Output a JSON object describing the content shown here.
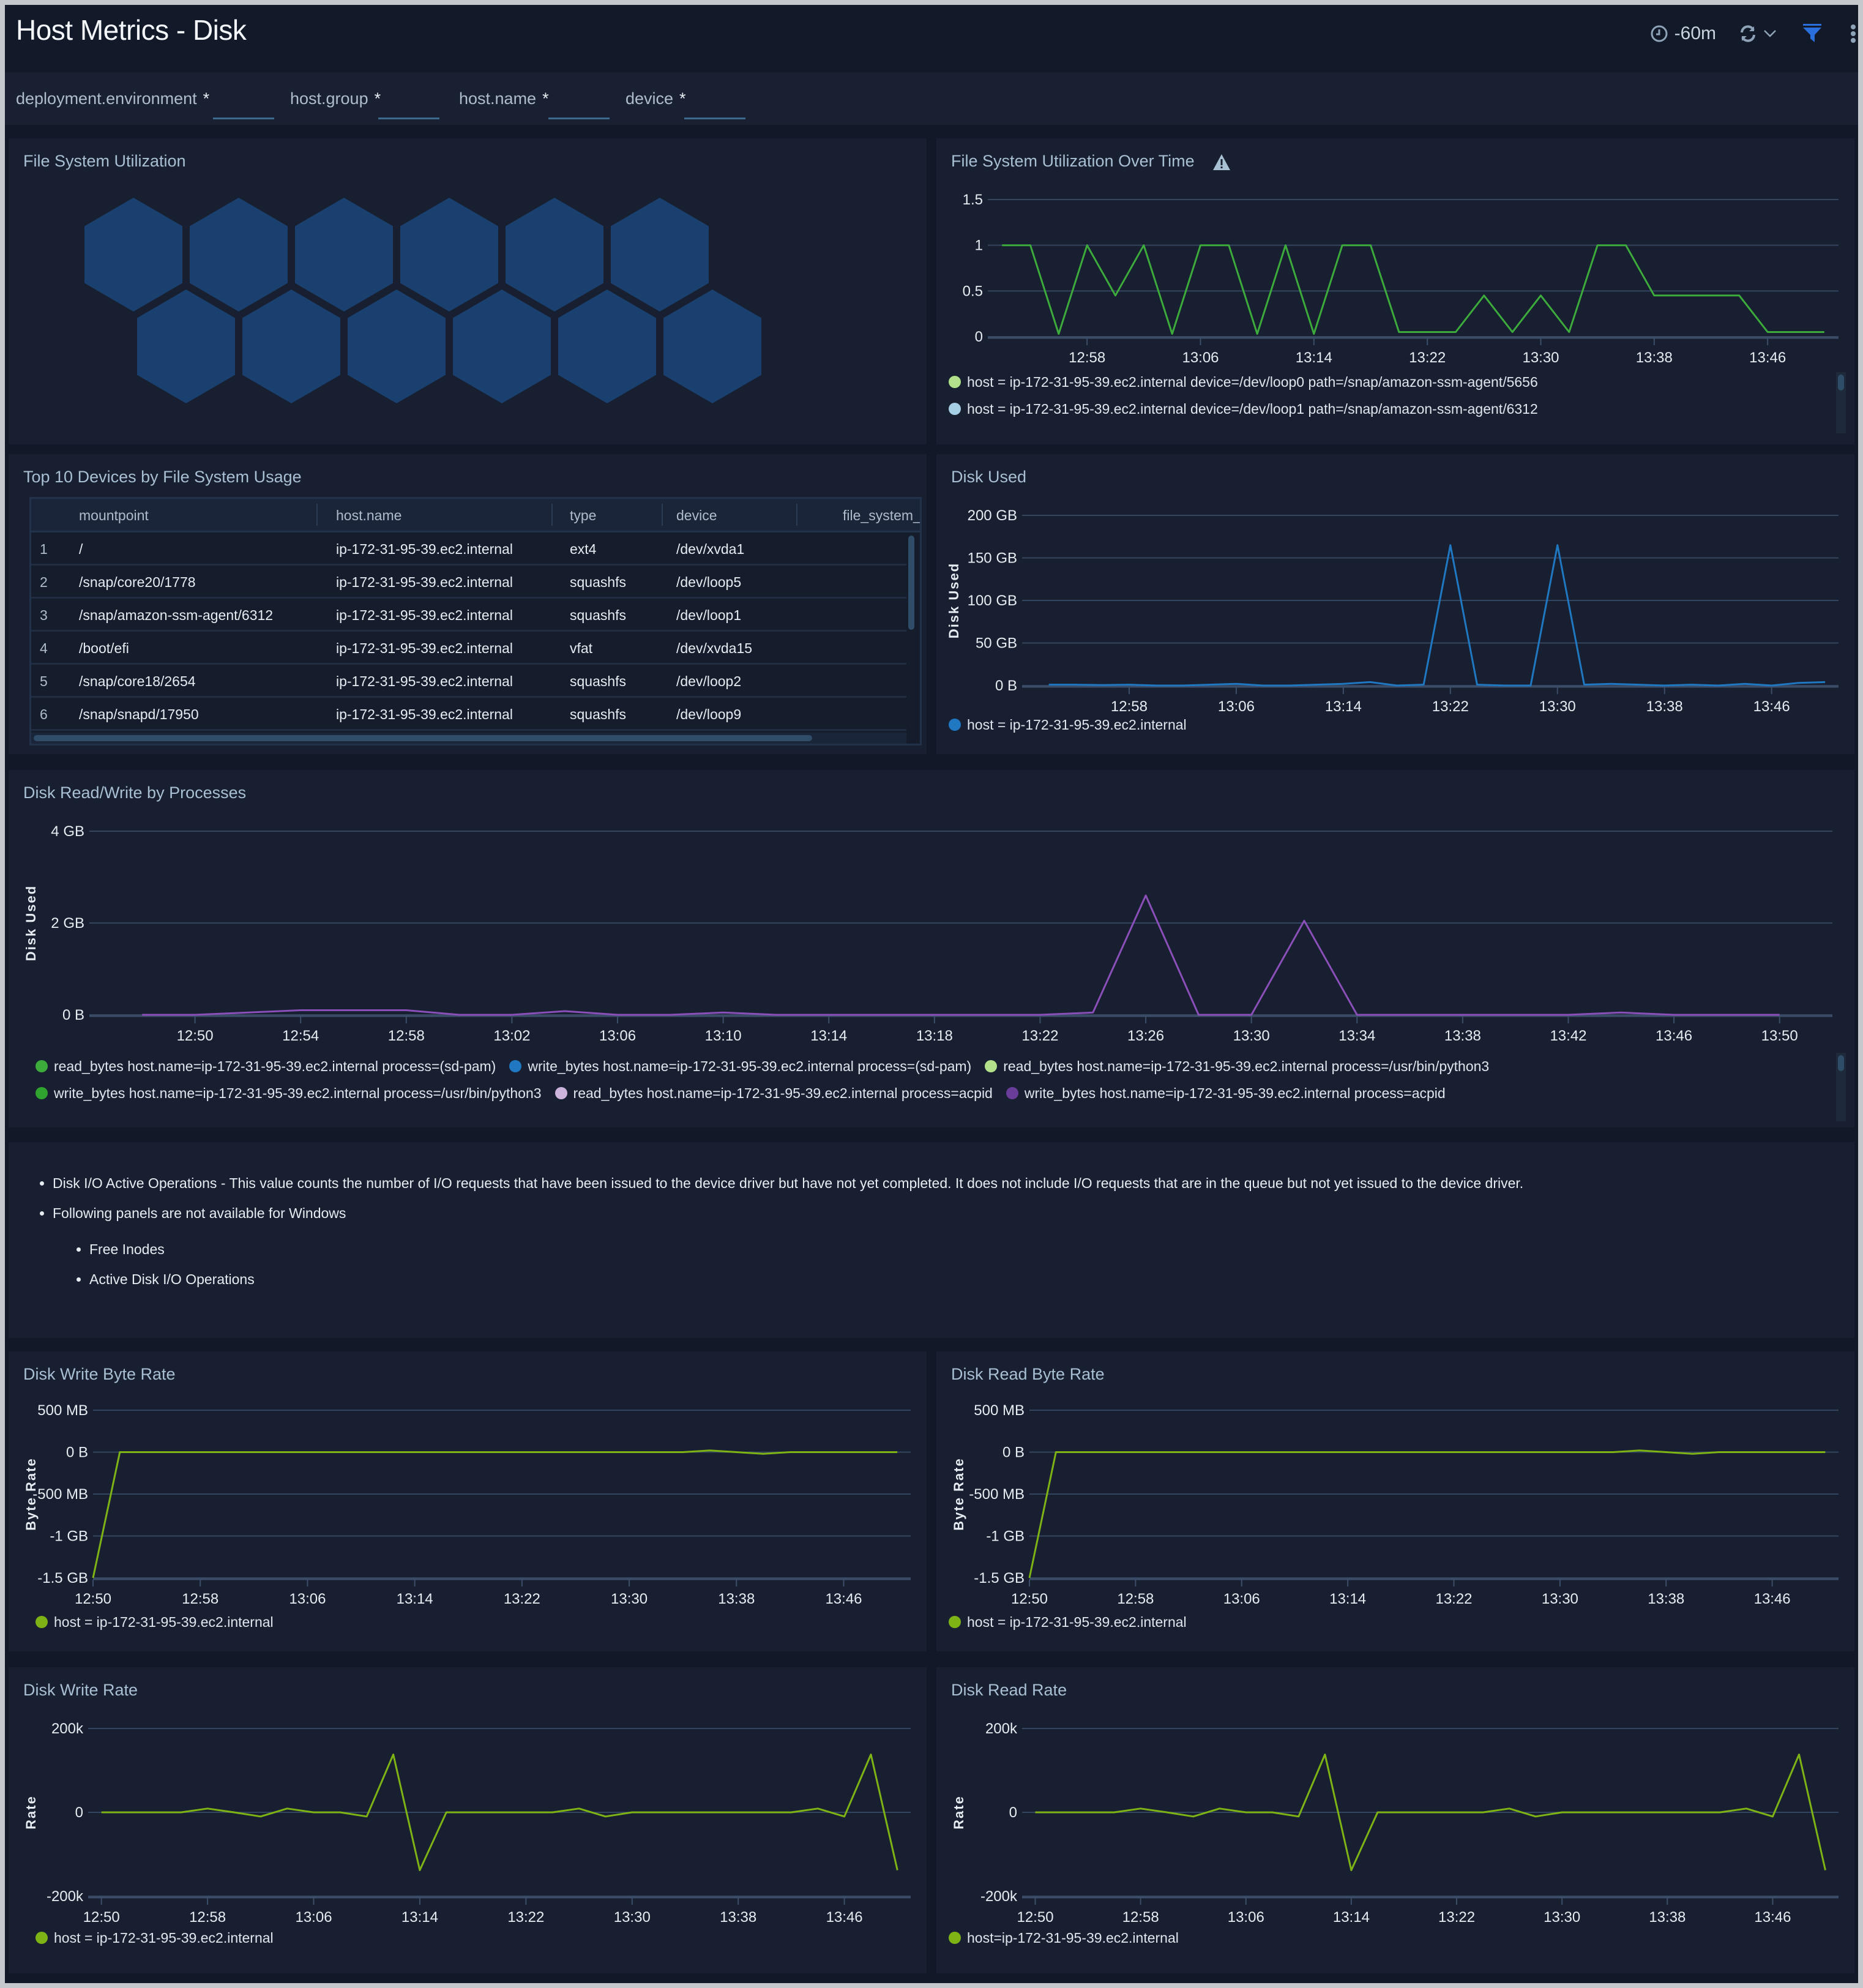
{
  "header": {
    "title": "Host Metrics - Disk",
    "time_range": "-60m",
    "icons": [
      "clock-icon",
      "refresh-icon",
      "chevron-down-icon",
      "filter-icon",
      "more-vertical-icon"
    ]
  },
  "filters": [
    {
      "label": "deployment.environment",
      "value": "*"
    },
    {
      "label": "host.group",
      "value": "*"
    },
    {
      "label": "host.name",
      "value": "*"
    },
    {
      "label": "device",
      "value": "*"
    }
  ],
  "panels": {
    "fs_util": {
      "title": "File System Utilization",
      "hex_count": 12,
      "hex_color": "#1a406f"
    },
    "fs_util_time": {
      "title": "File System Utilization Over Time",
      "warning_icon": "warning-icon"
    },
    "top10": {
      "title": "Top 10 Devices by File System Usage"
    },
    "disk_used": {
      "title": "Disk Used"
    },
    "rw_processes": {
      "title": "Disk Read/Write by Processes"
    },
    "write_byte_rate": {
      "title": "Disk Write Byte Rate"
    },
    "read_byte_rate": {
      "title": "Disk Read Byte Rate"
    },
    "write_rate": {
      "title": "Disk Write Rate"
    },
    "read_rate": {
      "title": "Disk Read Rate"
    }
  },
  "table": {
    "columns": [
      "mountpoint",
      "host.name",
      "type",
      "device",
      "file_system_"
    ],
    "rows": [
      {
        "idx": "1",
        "mountpoint": "/",
        "host": "ip-172-31-95-39.ec2.internal",
        "type": "ext4",
        "device": "/dev/xvda1"
      },
      {
        "idx": "2",
        "mountpoint": "/snap/core20/1778",
        "host": "ip-172-31-95-39.ec2.internal",
        "type": "squashfs",
        "device": "/dev/loop5"
      },
      {
        "idx": "3",
        "mountpoint": "/snap/amazon-ssm-agent/6312",
        "host": "ip-172-31-95-39.ec2.internal",
        "type": "squashfs",
        "device": "/dev/loop1"
      },
      {
        "idx": "4",
        "mountpoint": "/boot/efi",
        "host": "ip-172-31-95-39.ec2.internal",
        "type": "vfat",
        "device": "/dev/xvda15"
      },
      {
        "idx": "5",
        "mountpoint": "/snap/core18/2654",
        "host": "ip-172-31-95-39.ec2.internal",
        "type": "squashfs",
        "device": "/dev/loop2"
      },
      {
        "idx": "6",
        "mountpoint": "/snap/snapd/17950",
        "host": "ip-172-31-95-39.ec2.internal",
        "type": "squashfs",
        "device": "/dev/loop9"
      }
    ]
  },
  "notes": {
    "items": [
      "Disk I/O Active Operations - This value counts the number of I/O requests that have been issued to the device driver but have not yet completed. It does not include I/O requests that are in the queue but not yet issued to the device driver.",
      "Following panels are not available for Windows"
    ],
    "subitems": [
      "Free Inodes",
      "Active Disk I/O Operations"
    ]
  },
  "chart_data": [
    {
      "id": "fs_util_time",
      "type": "line",
      "title": "File System Utilization Over Time",
      "xlabel": "",
      "ylabel": "",
      "x_ticks": [
        "12:58",
        "13:06",
        "13:14",
        "13:22",
        "13:30",
        "13:38",
        "13:46"
      ],
      "y_ticks": [
        "0",
        "0.5",
        "1",
        "1.5"
      ],
      "ylim": [
        0,
        1.5
      ],
      "x_range": [
        54.5,
        52.5
      ],
      "series": [
        {
          "name": "host = ip-172-31-95-39.ec2.internal device=/dev/loop0 path=/snap/amazon-ssm-agent/5656",
          "color": "#3cab3c",
          "x": [
            0,
            2,
            4,
            6,
            8,
            10,
            12,
            14,
            16,
            18,
            20,
            22,
            24,
            26,
            28,
            30,
            32,
            34,
            36,
            38,
            40,
            42,
            44,
            46,
            48,
            50,
            52,
            54,
            56,
            58
          ],
          "values": [
            1,
            1,
            0.03,
            1,
            0.45,
            1,
            0.03,
            1,
            1,
            0.03,
            1,
            0.03,
            1,
            1,
            0.05,
            0.05,
            0.05,
            0.45,
            0.05,
            0.45,
            0.05,
            1,
            1,
            0.45,
            0.45,
            0.45,
            0.45,
            0.05,
            0.05,
            0.05
          ]
        }
      ],
      "legend": [
        {
          "label": "host = ip-172-31-95-39.ec2.internal device=/dev/loop0 path=/snap/amazon-ssm-agent/5656",
          "color": "#b3e08a"
        },
        {
          "label": "host = ip-172-31-95-39.ec2.internal device=/dev/loop1 path=/snap/amazon-ssm-agent/6312",
          "color": "#a6cfe6"
        }
      ]
    },
    {
      "id": "disk_used",
      "type": "line",
      "title": "Disk Used",
      "ylabel": "Disk Used",
      "x_ticks": [
        "12:58",
        "13:06",
        "13:14",
        "13:22",
        "13:30",
        "13:38",
        "13:46"
      ],
      "y_ticks": [
        "0 B",
        "50 GB",
        "100 GB",
        "150 GB",
        "200 GB"
      ],
      "ylim": [
        0,
        200
      ],
      "series": [
        {
          "name": "host = ip-172-31-95-39.ec2.internal",
          "color": "#1f78c1",
          "x": [
            0,
            2,
            4,
            6,
            8,
            10,
            12,
            14,
            16,
            18,
            20,
            22,
            24,
            26,
            28,
            30,
            32,
            34,
            36,
            38,
            40,
            42,
            44,
            46,
            48,
            50,
            52,
            54,
            56,
            58
          ],
          "values": [
            1,
            1,
            0.5,
            1,
            0,
            0,
            1,
            2,
            0,
            0,
            1,
            2,
            4,
            0,
            1,
            165,
            1,
            0,
            0,
            165,
            1,
            2,
            1,
            0,
            1,
            0,
            2,
            0,
            3,
            4
          ]
        }
      ],
      "legend": [
        {
          "label": "host = ip-172-31-95-39.ec2.internal",
          "color": "#1f78c1"
        }
      ]
    },
    {
      "id": "rw_processes",
      "type": "line",
      "title": "Disk Read/Write by Processes",
      "ylabel": "Disk Used",
      "x_ticks": [
        "12:50",
        "12:54",
        "12:58",
        "13:02",
        "13:06",
        "13:10",
        "13:14",
        "13:18",
        "13:22",
        "13:26",
        "13:30",
        "13:34",
        "13:38",
        "13:42",
        "13:46",
        "13:50"
      ],
      "y_ticks": [
        "0 B",
        "2 GB",
        "4 GB"
      ],
      "ylim": [
        0,
        4
      ],
      "series": [
        {
          "name": "write_bytes host.name=ip-172-31-95-39.ec2.internal process=acpid",
          "color": "#8a4fb8",
          "x": [
            0,
            2,
            4,
            6,
            8,
            10,
            12,
            14,
            16,
            18,
            20,
            22,
            24,
            26,
            28,
            30,
            32,
            34,
            36,
            38,
            40,
            42,
            44,
            46,
            48,
            50,
            52,
            54,
            56,
            58,
            60,
            62
          ],
          "values": [
            0,
            0,
            0.05,
            0.1,
            0.1,
            0.1,
            0,
            0,
            0.08,
            0,
            0,
            0.05,
            0,
            0,
            0,
            0,
            0,
            0,
            0.05,
            2.6,
            0,
            0,
            2.05,
            0,
            0,
            0,
            0,
            0,
            0.05,
            0,
            0,
            0
          ]
        }
      ],
      "legend": [
        {
          "label": "read_bytes host.name=ip-172-31-95-39.ec2.internal process=(sd-pam)",
          "color": "#3cab3c"
        },
        {
          "label": "write_bytes host.name=ip-172-31-95-39.ec2.internal process=(sd-pam)",
          "color": "#1f78c1"
        },
        {
          "label": "read_bytes host.name=ip-172-31-95-39.ec2.internal process=/usr/bin/python3",
          "color": "#b3e08a"
        },
        {
          "label": "write_bytes host.name=ip-172-31-95-39.ec2.internal process=/usr/bin/python3",
          "color": "#2fa52f"
        },
        {
          "label": "read_bytes host.name=ip-172-31-95-39.ec2.internal process=acpid",
          "color": "#cdb4dc"
        },
        {
          "label": "write_bytes host.name=ip-172-31-95-39.ec2.internal process=acpid",
          "color": "#6a3d9a"
        }
      ]
    },
    {
      "id": "write_byte_rate",
      "type": "line",
      "title": "Disk Write Byte Rate",
      "ylabel": "Byte Rate",
      "x_ticks": [
        "12:50",
        "12:58",
        "13:06",
        "13:14",
        "13:22",
        "13:30",
        "13:38",
        "13:46"
      ],
      "y_ticks": [
        "-1.5 GB",
        "-1 GB",
        "-500 MB",
        "0 B",
        "500 MB"
      ],
      "ylim": [
        -1.5,
        0.5
      ],
      "series": [
        {
          "name": "host = ip-172-31-95-39.ec2.internal",
          "color": "#7eb315",
          "x": [
            0,
            2,
            4,
            6,
            8,
            10,
            12,
            14,
            16,
            18,
            20,
            22,
            24,
            26,
            28,
            30,
            32,
            34,
            36,
            38,
            40,
            42,
            44,
            46,
            48,
            50,
            52,
            54,
            56,
            58,
            60
          ],
          "values": [
            -1.5,
            0,
            0,
            0,
            0,
            0,
            0,
            0,
            0,
            0,
            0,
            0,
            0,
            0,
            0,
            0,
            0,
            0,
            0,
            0,
            0,
            0,
            0,
            0.02,
            0,
            -0.02,
            0,
            0,
            0,
            0,
            0
          ]
        }
      ],
      "legend": [
        {
          "label": "host = ip-172-31-95-39.ec2.internal",
          "color": "#7eb315"
        }
      ]
    },
    {
      "id": "read_byte_rate",
      "type": "line",
      "title": "Disk Read Byte Rate",
      "ylabel": "Byte Rate",
      "x_ticks": [
        "12:50",
        "12:58",
        "13:06",
        "13:14",
        "13:22",
        "13:30",
        "13:38",
        "13:46"
      ],
      "y_ticks": [
        "-1.5 GB",
        "-1 GB",
        "-500 MB",
        "0 B",
        "500 MB"
      ],
      "ylim": [
        -1.5,
        0.5
      ],
      "series": [
        {
          "name": "host = ip-172-31-95-39.ec2.internal",
          "color": "#7eb315",
          "x": [
            0,
            2,
            4,
            6,
            8,
            10,
            12,
            14,
            16,
            18,
            20,
            22,
            24,
            26,
            28,
            30,
            32,
            34,
            36,
            38,
            40,
            42,
            44,
            46,
            48,
            50,
            52,
            54,
            56,
            58,
            60
          ],
          "values": [
            -1.5,
            0,
            0,
            0,
            0,
            0,
            0,
            0,
            0,
            0,
            0,
            0,
            0,
            0,
            0,
            0,
            0,
            0,
            0,
            0,
            0,
            0,
            0,
            0.02,
            0,
            -0.02,
            0,
            0,
            0,
            0,
            0
          ]
        }
      ],
      "legend": [
        {
          "label": "host = ip-172-31-95-39.ec2.internal",
          "color": "#7eb315"
        }
      ]
    },
    {
      "id": "write_rate",
      "type": "line",
      "title": "Disk Write Rate",
      "ylabel": "Rate",
      "x_ticks": [
        "12:50",
        "12:58",
        "13:06",
        "13:14",
        "13:22",
        "13:30",
        "13:38",
        "13:46"
      ],
      "y_ticks": [
        "-200k",
        "0",
        "200k"
      ],
      "ylim": [
        -200000,
        200000
      ],
      "series": [
        {
          "name": "host = ip-172-31-95-39.ec2.internal",
          "color": "#7eb315",
          "x": [
            0,
            2,
            4,
            6,
            8,
            10,
            12,
            14,
            16,
            18,
            20,
            22,
            24,
            26,
            28,
            30,
            32,
            34,
            36,
            38,
            40,
            42,
            44,
            46,
            48,
            50,
            52,
            54,
            56,
            58,
            60
          ],
          "values": [
            0,
            0,
            0,
            0,
            9000,
            0,
            -10000,
            9000,
            0,
            0,
            -10000,
            138000,
            -138000,
            0,
            0,
            0,
            0,
            0,
            9000,
            -10000,
            0,
            0,
            0,
            0,
            0,
            0,
            0,
            9000,
            -10000,
            138000,
            -138000
          ]
        }
      ],
      "legend": [
        {
          "label": "host = ip-172-31-95-39.ec2.internal",
          "color": "#7eb315"
        }
      ]
    },
    {
      "id": "read_rate",
      "type": "line",
      "title": "Disk Read Rate",
      "ylabel": "Rate",
      "x_ticks": [
        "12:50",
        "12:58",
        "13:06",
        "13:14",
        "13:22",
        "13:30",
        "13:38",
        "13:46"
      ],
      "y_ticks": [
        "-200k",
        "0",
        "200k"
      ],
      "ylim": [
        -200000,
        200000
      ],
      "series": [
        {
          "name": "host=ip-172-31-95-39.ec2.internal",
          "color": "#7eb315",
          "x": [
            0,
            2,
            4,
            6,
            8,
            10,
            12,
            14,
            16,
            18,
            20,
            22,
            24,
            26,
            28,
            30,
            32,
            34,
            36,
            38,
            40,
            42,
            44,
            46,
            48,
            50,
            52,
            54,
            56,
            58,
            60
          ],
          "values": [
            0,
            0,
            0,
            0,
            9000,
            0,
            -10000,
            9000,
            0,
            0,
            -10000,
            138000,
            -138000,
            0,
            0,
            0,
            0,
            0,
            9000,
            -10000,
            0,
            0,
            0,
            0,
            0,
            0,
            0,
            9000,
            -10000,
            138000,
            -138000
          ]
        }
      ],
      "legend": [
        {
          "label": "host=ip-172-31-95-39.ec2.internal",
          "color": "#7eb315"
        }
      ]
    }
  ]
}
